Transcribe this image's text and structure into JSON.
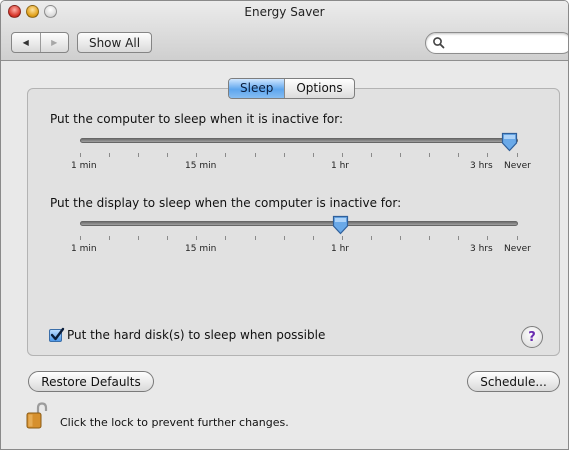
{
  "window": {
    "title": "Energy Saver"
  },
  "toolbar": {
    "back_icon": "left-triangle",
    "forward_icon": "right-triangle",
    "show_all_label": "Show All",
    "search": {
      "value": "",
      "placeholder": ""
    }
  },
  "tabs": [
    {
      "label": "Sleep",
      "selected": true
    },
    {
      "label": "Options",
      "selected": false
    }
  ],
  "computer_sleep": {
    "label": "Put the computer to sleep when it is inactive for:",
    "selected": "Never",
    "ticks": {
      "min": "1 min",
      "m15": "15 min",
      "hr1": "1 hr",
      "hrs3": "3 hrs",
      "never": "Never"
    }
  },
  "display_sleep": {
    "label": "Put the display to sleep when the computer is inactive for:",
    "selected": "1 hr",
    "ticks": {
      "min": "1 min",
      "m15": "15 min",
      "hr1": "1 hr",
      "hrs3": "3 hrs",
      "never": "Never"
    }
  },
  "hard_disk": {
    "label": "Put the hard disk(s) to sleep when possible",
    "checked": true
  },
  "help_label": "?",
  "buttons": {
    "restore_defaults": "Restore Defaults",
    "schedule": "Schedule..."
  },
  "lock": {
    "text": "Click the lock to prevent further changes.",
    "state": "unlocked"
  },
  "colors": {
    "accent": "#5ea6ee",
    "knob": "#6aa9e8"
  }
}
